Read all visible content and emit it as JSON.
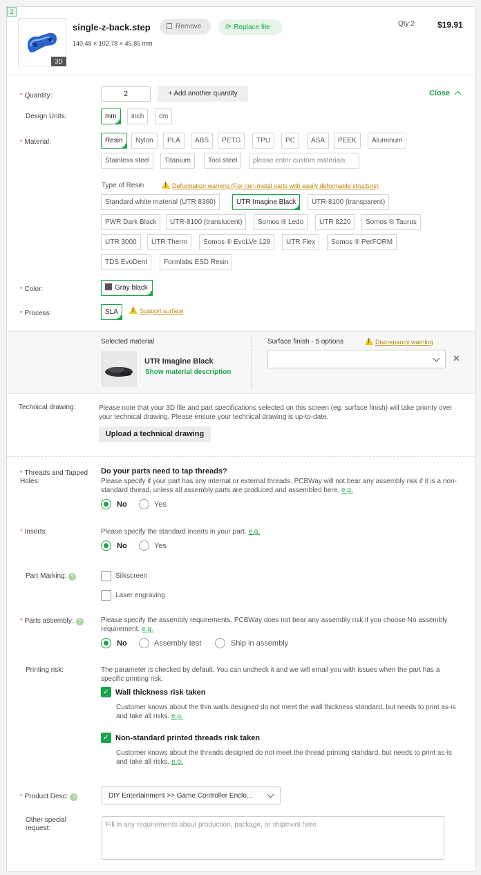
{
  "part": {
    "index": "2",
    "file_name": "single-z-back.step",
    "remove_label": "Remove",
    "replace_label": "Replace file",
    "dimensions": "140.48 × 102.78 × 45.85 mm",
    "badge_3d": "3D",
    "qty_text": "Qty:2",
    "price": "$19.91"
  },
  "quantity": {
    "label": "Quantity:",
    "value": "2",
    "add_label": "+ Add another quantity",
    "close_label": "Close"
  },
  "units": {
    "label": "Design Units:",
    "options": [
      "mm",
      "inch",
      "cm"
    ],
    "selected": "mm"
  },
  "material": {
    "label": "Material:",
    "options": [
      "Resin",
      "Nylon",
      "PLA",
      "ABS",
      "PETG",
      "TPU",
      "PC",
      "ASA",
      "PEEK",
      "Aluminum",
      "Stainless steel",
      "Titanium",
      "Tool steel"
    ],
    "custom_placeholder": "please enter custom materials",
    "selected": "Resin"
  },
  "resin": {
    "type_label": "Type of Resin",
    "warning": "Deformation warning (For non-metal parts with easily deformable structure)",
    "options": [
      "Standard white material (UTR 8360)",
      "UTR Imagine Black",
      "UTR-8100 (transparent)",
      "PWR Dark Black",
      "UTR-8100 (translucent)",
      "Somos ® Ledo",
      "UTR 8220",
      "Somos ® Taurus",
      "UTR 3000",
      "UTR Therm",
      "Somos ® EvoLVe 128",
      "UTR Flex",
      "Somos ® PerFORM",
      "TDS EvoDent",
      "Formlabs ESD Resin"
    ],
    "selected": "UTR Imagine Black"
  },
  "color": {
    "label": "Color:",
    "value": "Gray black",
    "swatch": "#555555"
  },
  "process": {
    "label": "Process:",
    "value": "SLA",
    "support_label": "Support surface"
  },
  "selected_material": {
    "heading": "Selected material",
    "name": "UTR Imagine Black",
    "desc_link": "Show material description",
    "finish_heading": "Surface finish - 5 options",
    "finish_warning": "Discrepancy warning",
    "finish_value": ""
  },
  "drawing": {
    "label": "Technical drawing:",
    "note": "Please note that your 3D file and part specifications selected on this screen (eg. surface finish) will take priority over your technical drawing. Please ensure your technical drawing is up-to-date.",
    "upload_label": "Upload a technical drawing"
  },
  "threads": {
    "label": "Threads and Tapped Holes:",
    "question": "Do your parts need to tap threads?",
    "desc": "Please specify if your part has any internal or external threads. PCBWay will not bear any assembly risk if it is a non-standard thread, unless all assembly parts are produced and assembled here.",
    "eg": "e.g.",
    "options": [
      "No",
      "Yes"
    ],
    "selected": "No"
  },
  "inserts": {
    "label": "Inserts:",
    "desc": "Please specify the standard inserts in your part.",
    "eg": "e.g.",
    "options": [
      "No",
      "Yes"
    ],
    "selected": "No"
  },
  "marking": {
    "label": "Part Marking:",
    "options": [
      "Silkscreen",
      "Laser engraving"
    ]
  },
  "assembly": {
    "label": "Parts assembly:",
    "desc": "Please specify the assembly requirements. PCBWay does not bear any assembly risk if you choose No assembly requirement.",
    "eg": "e.g.",
    "options": [
      "No",
      "Assembly test",
      "Ship in assembly"
    ],
    "selected": "No"
  },
  "printing_risk": {
    "label": "Printing risk:",
    "desc": "The parameter is checked by default. You can uncheck it and we will email you with issues when the part has a specific printing risk.",
    "items": [
      {
        "title": "Wall thickness risk taken",
        "desc": "Customer knows about the thin walls designed do not meet the wall thickness standard, but needs to print as-is and take all risks.",
        "eg": "e.g."
      },
      {
        "title": "Non-standard printed threads risk taken",
        "desc": "Customer knows about the threads designed do not meet the thread printing standard, but needs to print as-is and take all risks.",
        "eg": "e.g."
      }
    ]
  },
  "product_desc": {
    "label": "Product Desc:",
    "value": "DIY Entertainment >> Game Controller Enclo..."
  },
  "special": {
    "label": "Other special request:",
    "placeholder": "Fill in any requirements about production, package, or shipment here."
  },
  "colors": {
    "accent": "#1aa348",
    "warning": "#f0c419",
    "required": "#e0362c"
  }
}
